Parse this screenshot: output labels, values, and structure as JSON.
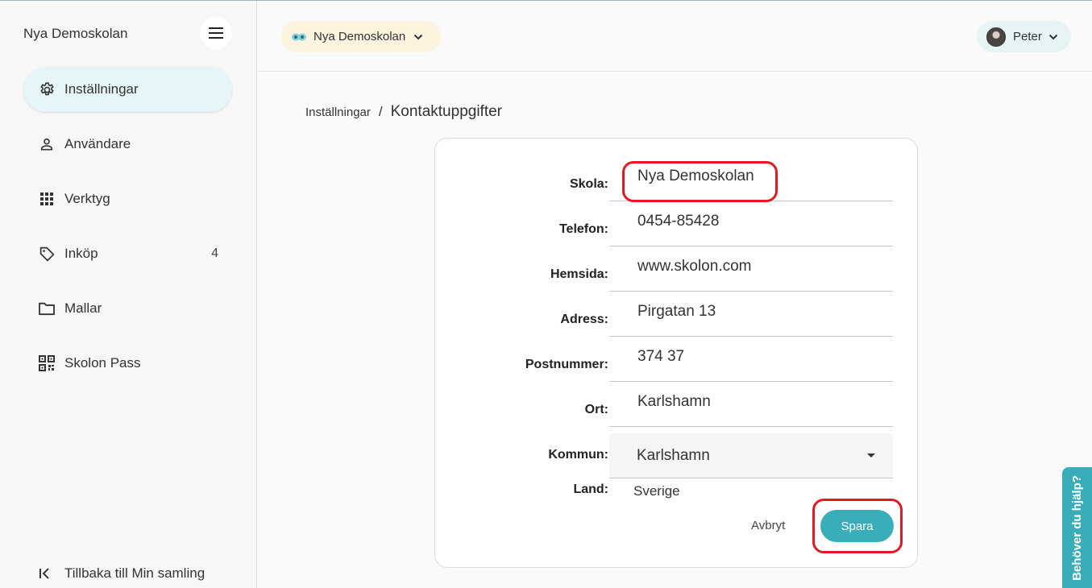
{
  "sidebar": {
    "school_name": "Nya Demoskolan",
    "items": [
      {
        "label": "Inställningar",
        "icon": "gear-icon",
        "active": true
      },
      {
        "label": "Användare",
        "icon": "person-icon"
      },
      {
        "label": "Verktyg",
        "icon": "grid-icon"
      },
      {
        "label": "Inköp",
        "icon": "tag-icon",
        "count": "4"
      },
      {
        "label": "Mallar",
        "icon": "folder-icon"
      },
      {
        "label": "Skolon Pass",
        "icon": "qr-code-icon"
      }
    ],
    "back_label": "Tillbaka till Min samling"
  },
  "header": {
    "school_selector": "Nya Demoskolan",
    "user_name": "Peter"
  },
  "breadcrumb": {
    "parent": "Inställningar",
    "separator": "/",
    "current": "Kontaktuppgifter"
  },
  "form": {
    "fields": [
      {
        "label": "Skola:",
        "value": "Nya Demoskolan"
      },
      {
        "label": "Telefon:",
        "value": "0454-85428"
      },
      {
        "label": "Hemsida:",
        "value": "www.skolon.com"
      },
      {
        "label": "Adress:",
        "value": "Pirgatan 13"
      },
      {
        "label": "Postnummer:",
        "value": "374 37"
      },
      {
        "label": "Ort:",
        "value": "Karlshamn"
      }
    ],
    "kommun_label": "Kommun:",
    "kommun_value": "Karlshamn",
    "land_label": "Land:",
    "land_value": "Sverige",
    "cancel_label": "Avbryt",
    "save_label": "Spara"
  },
  "help_tab": "Behöver du hjälp?",
  "colors": {
    "accent": "#3aaeb8",
    "active_nav_bg": "#e6f6f8",
    "school_chip_bg": "#fdf4e0",
    "annotation_red": "#e01b24"
  }
}
